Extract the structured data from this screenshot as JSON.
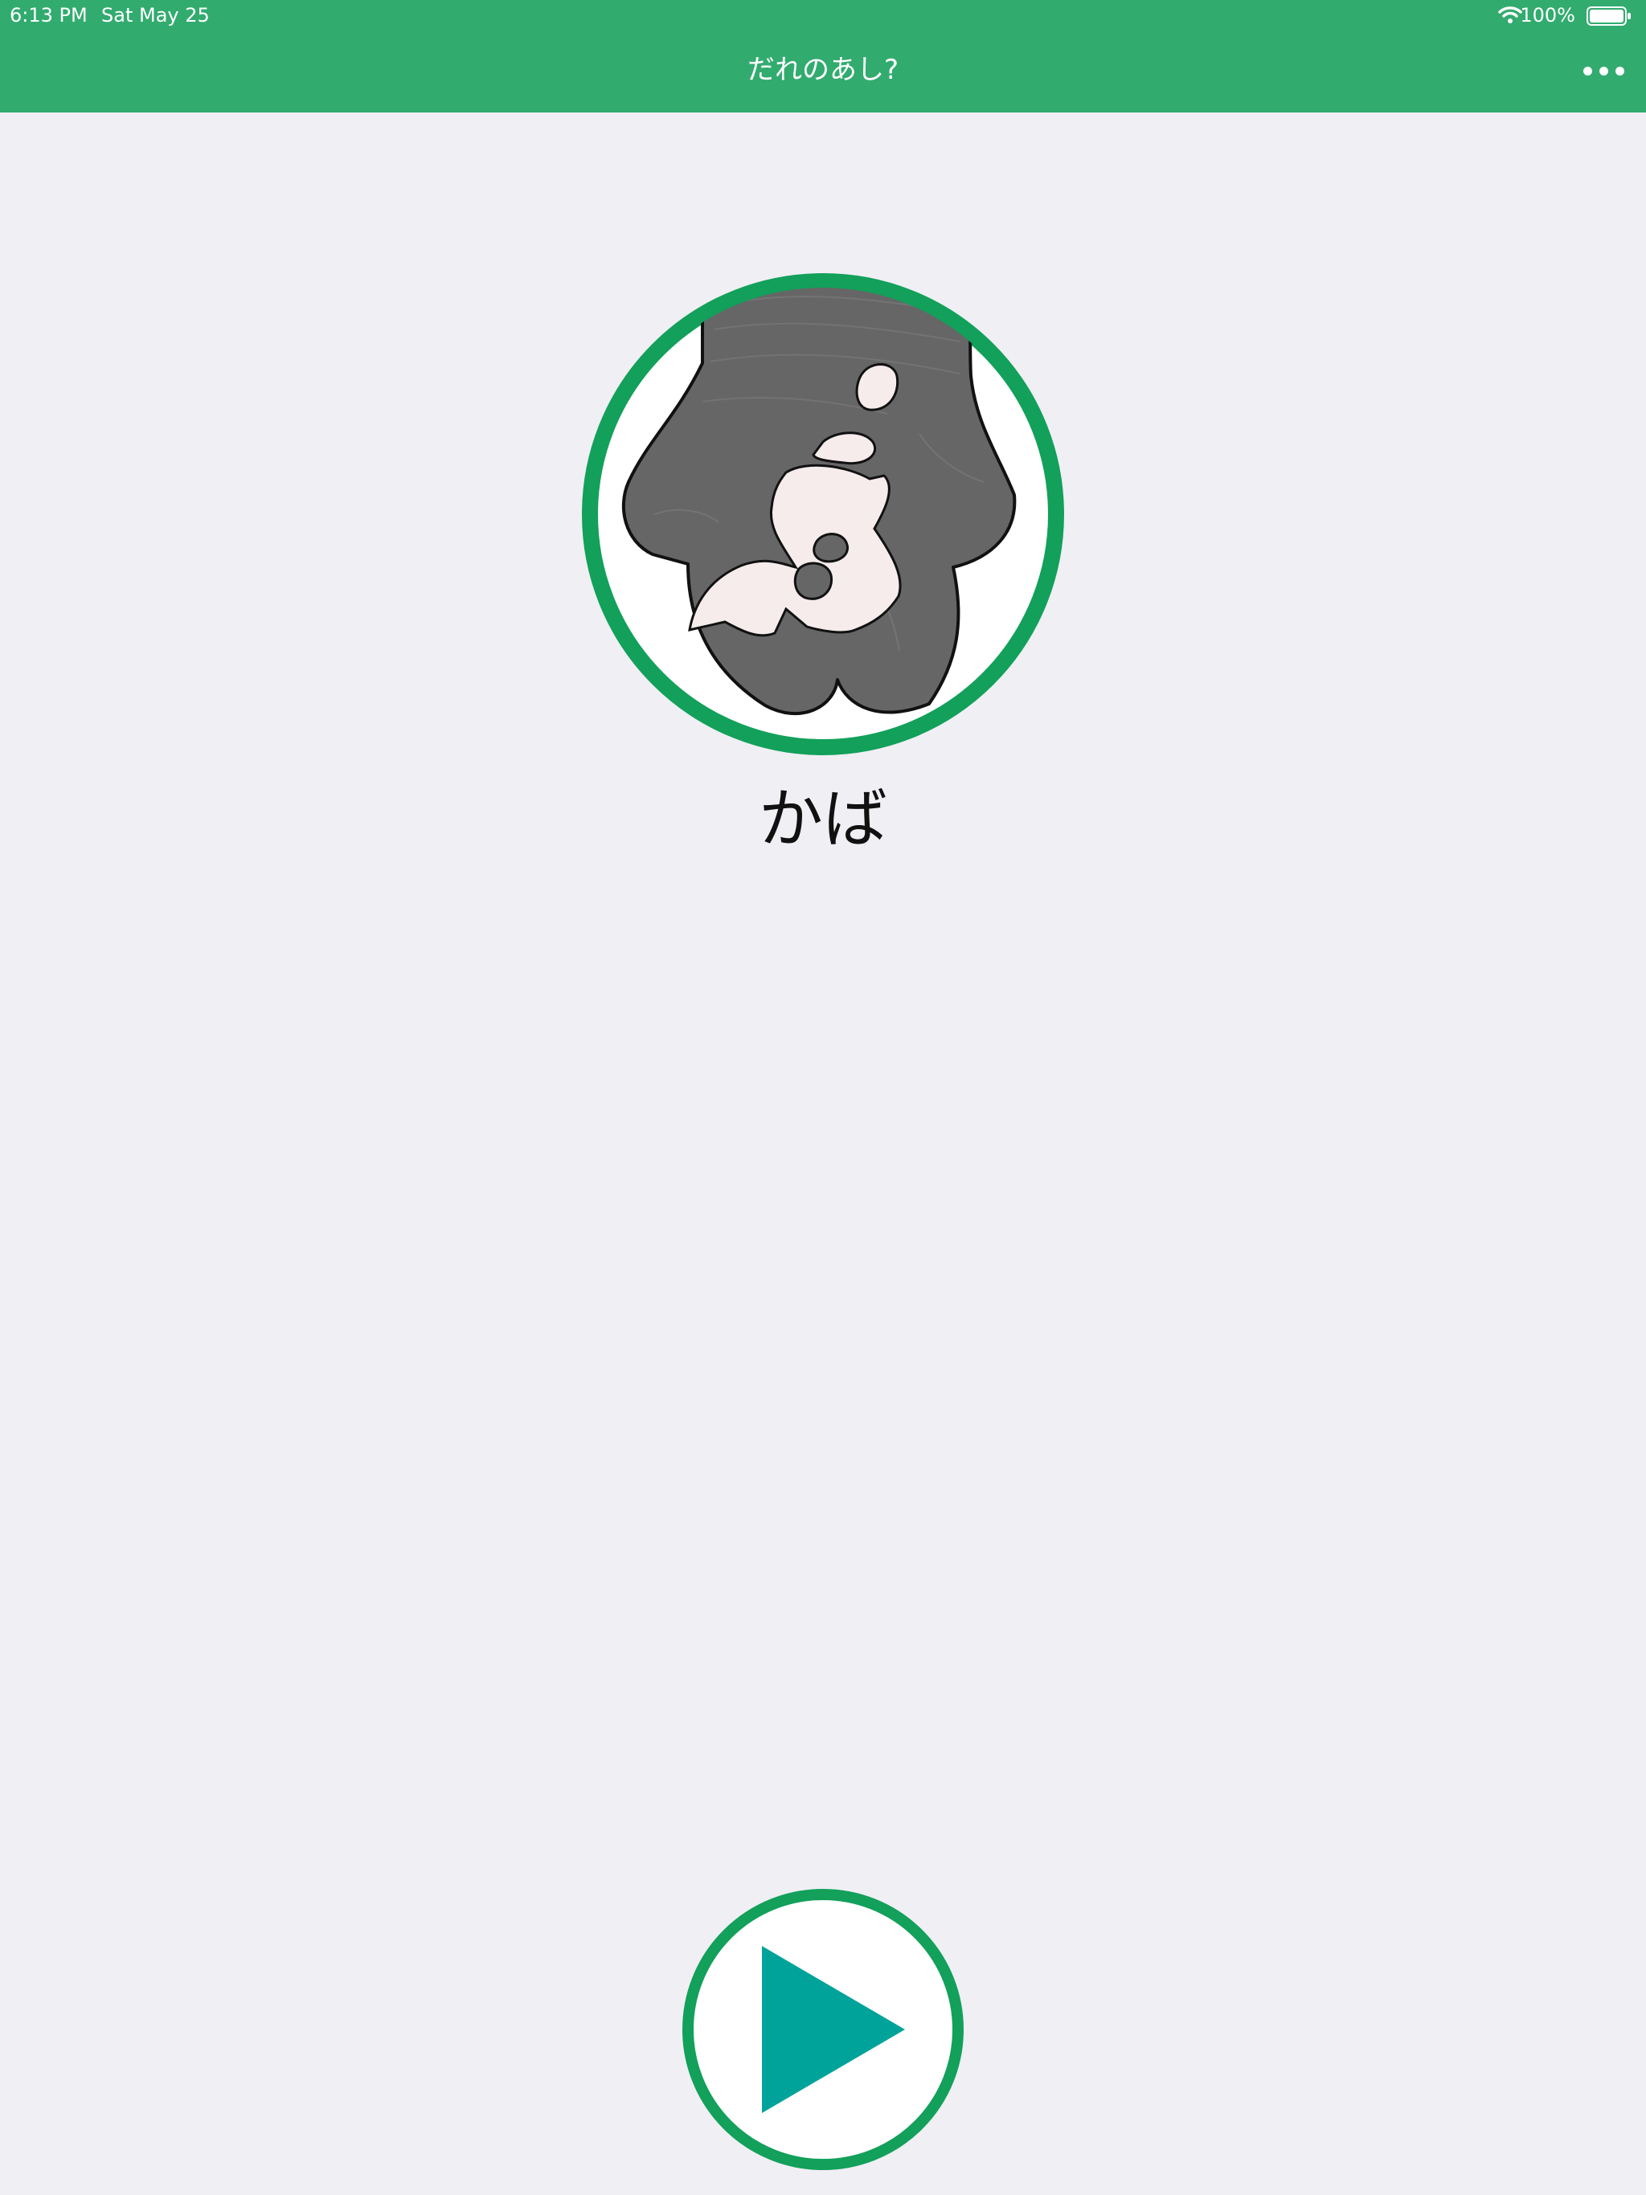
{
  "status_bar": {
    "time": "6:13 PM",
    "date": "Sat May 25",
    "battery": "100%"
  },
  "nav": {
    "title": "だれのあし?",
    "more_icon": "ellipsis-icon"
  },
  "card": {
    "image_icon": "hippo-foot-illustration",
    "animal_name": "かば"
  },
  "controls": {
    "play_icon": "play-icon"
  },
  "colors": {
    "accent_green": "#32ab6f",
    "ring_green": "#12a05a",
    "play_teal": "#00a39a",
    "background": "#efeff4",
    "foot_gray": "#666666",
    "pad_pink": "#f6ecec"
  }
}
